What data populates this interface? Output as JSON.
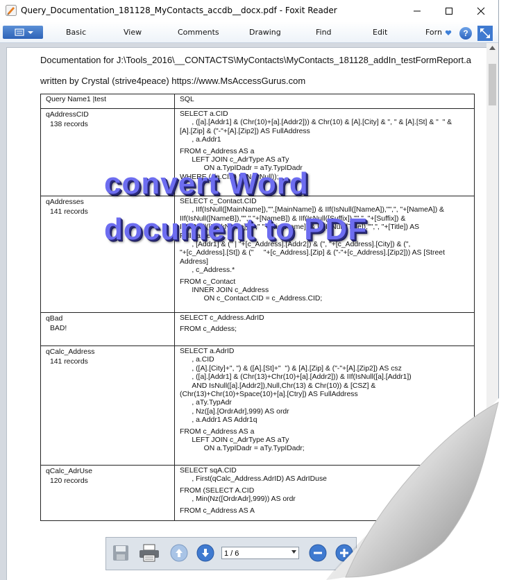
{
  "window": {
    "title": "Query_Documentation_181128_MyContacts_accdb__docx.pdf - Foxit Reader",
    "icons": [
      "foxit-app-icon",
      "minimize-icon",
      "maximize-icon",
      "close-icon"
    ]
  },
  "menu": {
    "items": [
      "Basic",
      "View",
      "Comments",
      "Drawing",
      "Find",
      "Edit",
      "Forn"
    ],
    "help_label": "?"
  },
  "document": {
    "header": "Documentation for J:\\Tools_2016\\__CONTACTS\\MyContacts\\MyContacts_181128_addIn_testFormReport.a",
    "author": "written by Crystal (strive4peace) https://www.MsAccessGurus.com",
    "table": {
      "headers": [
        "Query Name1 |test",
        "SQL"
      ],
      "rows": [
        {
          "name": "qAddressCID",
          "count": "138 records",
          "sql": [
            [
              "SELECT a.CID",
              "      , ([a].[Addr1] & (Chr(10)+[a].[Addr2])) & Chr(10) & [A].[City] & \", \" & [A].[St] & \"  \" &",
              "[A].[Zip] & (\"-\"+[A].[Zip2]) AS FullAddress",
              "      , a.Addr1"
            ],
            [
              "FROM c_Address AS a",
              "      LEFT JOIN c_AdrType AS aTy",
              "            ON a.TypIDadr = aTy.TypIDadr",
              "WHERE (((a.CID) Is Not Null));"
            ]
          ]
        },
        {
          "name": "qAddresses",
          "count": "141 records",
          "sql": [
            [
              "SELECT c_Contact.CID",
              "      , IIf(IsNull([MainName]),\"\",[MainName]) & IIf(IsNull([NameA]),\"\",\", \"+[NameA]) &",
              "IIf(IsNull([NameB]),\"\",\" \"+[NameB]) & IIf(IsNull([Suffix]),\"\",\", \"+[Suffix]) &",
              "IIf(IsNull([NickName]),\"\",\" \"+[NickName]) & IIf(IsNull([Title]),\"\",\", \"+[Title]) AS",
              "FullName",
              "      , [Addr1] & (\" | \"+[c_Address].[Addr2]) & (\", \"+[c_Address].[City]) & (\",",
              "\"+[c_Address].[St]) & (\"     \"+[c_Address].[Zip] & (\"-\"+[c_Address].[Zip2])) AS [Street",
              "Address]",
              "      , c_Address.*"
            ],
            [
              "FROM c_Contact",
              "      INNER JOIN c_Address",
              "            ON c_Contact.CID = c_Address.CID;"
            ]
          ]
        },
        {
          "name": "qBad",
          "count": "BAD!",
          "sql": [
            [
              "SELECT c_Address.AdrID"
            ],
            [
              "FROM c_Addess;"
            ]
          ]
        },
        {
          "name": "qCalc_Address",
          "count": "141 records",
          "sql": [
            [
              "SELECT a.AdrID",
              "      , a.CID",
              "      , ([A].[City]+\", \") & ([A].[St]+\"  \") & [A].[Zip] & (\"-\"+[A].[Zip2]) AS csz",
              "      , ([a].[Addr1] & (Chr(13)+Chr(10)+[a].[Addr2])) & IIf(IsNull([a].[Addr1])",
              "      AND IsNull([a].[Addr2]),Null,Chr(13) & Chr(10)) & [CSZ] &",
              "(Chr(13)+Chr(10)+Space(10)+[a].[Ctry]) AS FullAddress",
              "      , aTy.TypAdr",
              "      , Nz([a].[OrdrAdr],999) AS ordr",
              "      , a.Addr1 AS Addr1q"
            ],
            [
              "FROM c_Address AS a",
              "      LEFT JOIN c_AdrType AS aTy",
              "            ON a.TypIDadr = aTy.TypIDadr;"
            ]
          ]
        },
        {
          "name": "qCalc_AdrUse",
          "count": "120 records",
          "sql": [
            [
              "SELECT sqA.CID",
              "      , First(qCalc_Address.AdrID) AS AdrIDuse"
            ],
            [
              "FROM (SELECT A.CID",
              "      , Min(Nz([OrdrAdr],999)) AS ordr"
            ],
            [
              "FROM c_Address AS A"
            ]
          ]
        }
      ]
    }
  },
  "overlay": {
    "line1": "convert Word",
    "line2": "document to PDF",
    "color": "#6d6df0"
  },
  "bottom_toolbar": {
    "page_indicator": "1 / 6",
    "icons": [
      "save-icon",
      "print-icon",
      "page-up-icon",
      "page-down-icon",
      "zoom-out-icon",
      "zoom-in-icon"
    ]
  },
  "colors": {
    "accent": "#2d63b8",
    "viewer_background": "#d4d9e0"
  }
}
